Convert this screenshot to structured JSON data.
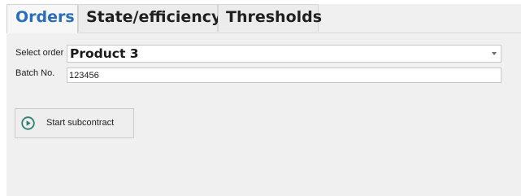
{
  "tabs": [
    {
      "label": "Orders",
      "active": true
    },
    {
      "label": "State/efficiency",
      "active": false
    },
    {
      "label": "Thresholds",
      "active": false
    }
  ],
  "form": {
    "select_order_label": "Select order",
    "select_order_value": "Product 3",
    "batch_label": "Batch No.",
    "batch_value": "123456"
  },
  "actions": {
    "start_label": "Start subcontract",
    "start_icon": "play-circle-icon"
  },
  "colors": {
    "active_tab_text": "#2a6ebb",
    "play_icon": "#2e7d6e",
    "panel_bg": "#f0f0f0"
  }
}
